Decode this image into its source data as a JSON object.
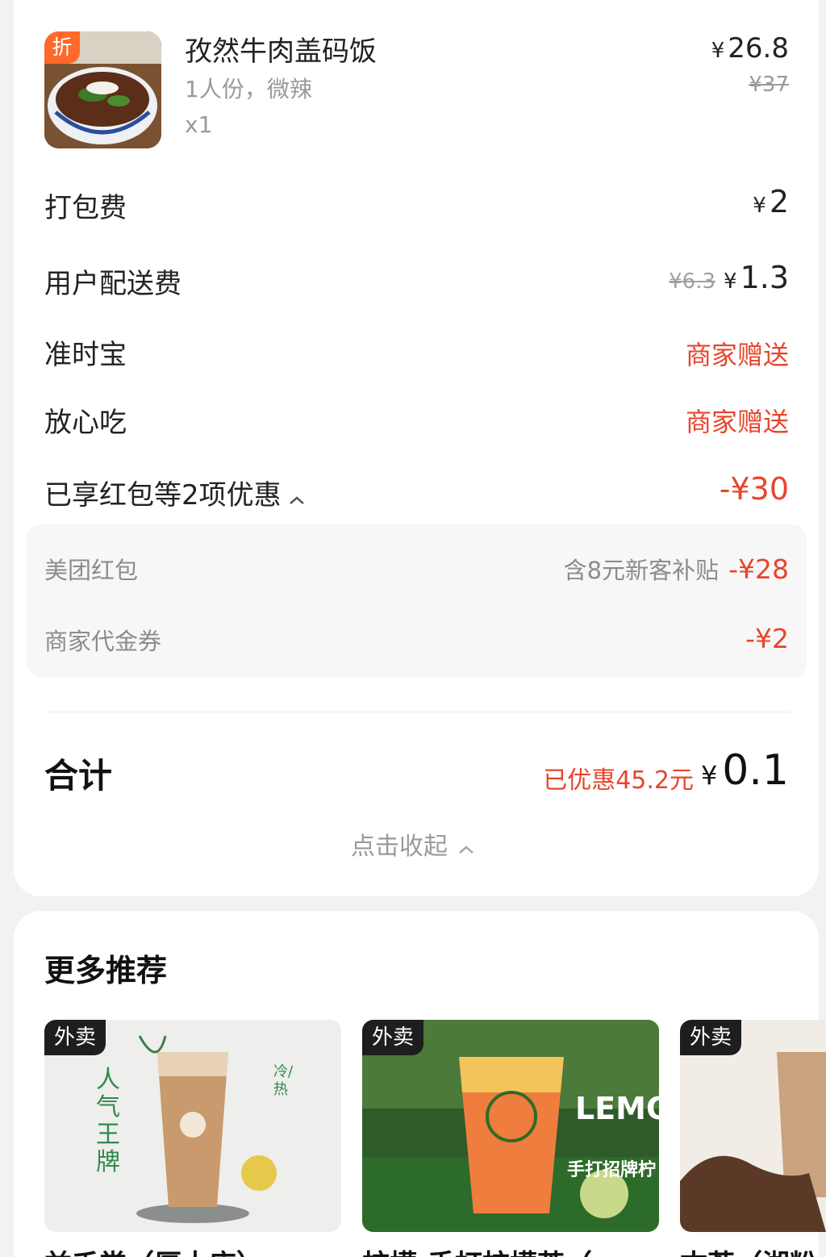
{
  "dish": {
    "badge": "折",
    "title": "孜然牛肉盖码饭",
    "spec": "1人份，微辣",
    "qty": "x1",
    "price_yen": "¥",
    "price": "26.8",
    "original_price": "¥37",
    "thumb_icon": "beef-rice-bowl-image"
  },
  "fees": [
    {
      "label": "打包费",
      "yen": "¥",
      "value": "2"
    },
    {
      "label": "用户配送费",
      "strike": "¥6.3",
      "yen": "¥",
      "value": "1.3"
    },
    {
      "label": "准时宝",
      "value": "商家赠送"
    },
    {
      "label": "放心吃",
      "value": "商家赠送"
    }
  ],
  "discounts": {
    "summary_label": "已享红包等2项优惠",
    "summary_value": "-¥30",
    "items": [
      {
        "label": "美团红包",
        "note": "含8元新客补贴",
        "value": "-¥28"
      },
      {
        "label": "商家代金券",
        "value": "-¥2"
      }
    ]
  },
  "total": {
    "label": "合计",
    "saved": "已优惠45.2元",
    "yen": "¥",
    "value": "0.1"
  },
  "collapse_label": "点击收起",
  "recommend": {
    "title": "更多推荐",
    "items": [
      {
        "tag": "外卖",
        "name": "益禾堂（厚木店）",
        "image": "milk-tea-cup-image",
        "poster_text": "人气王牌",
        "poster_side": "冷/热"
      },
      {
        "tag": "外卖",
        "name": "柠檬·手打柠檬茶（",
        "image": "lemon-tea-cup-image",
        "poster_text": "LEMO",
        "poster_sub": "手打招牌柠"
      },
      {
        "tag": "外卖",
        "name": "古茗（湘粉",
        "image": "bubble-tea-image"
      }
    ]
  },
  "colors": {
    "accent_red": "#e8452c",
    "badge_orange": "#ff6a2b",
    "background": "#f2f2f2"
  }
}
